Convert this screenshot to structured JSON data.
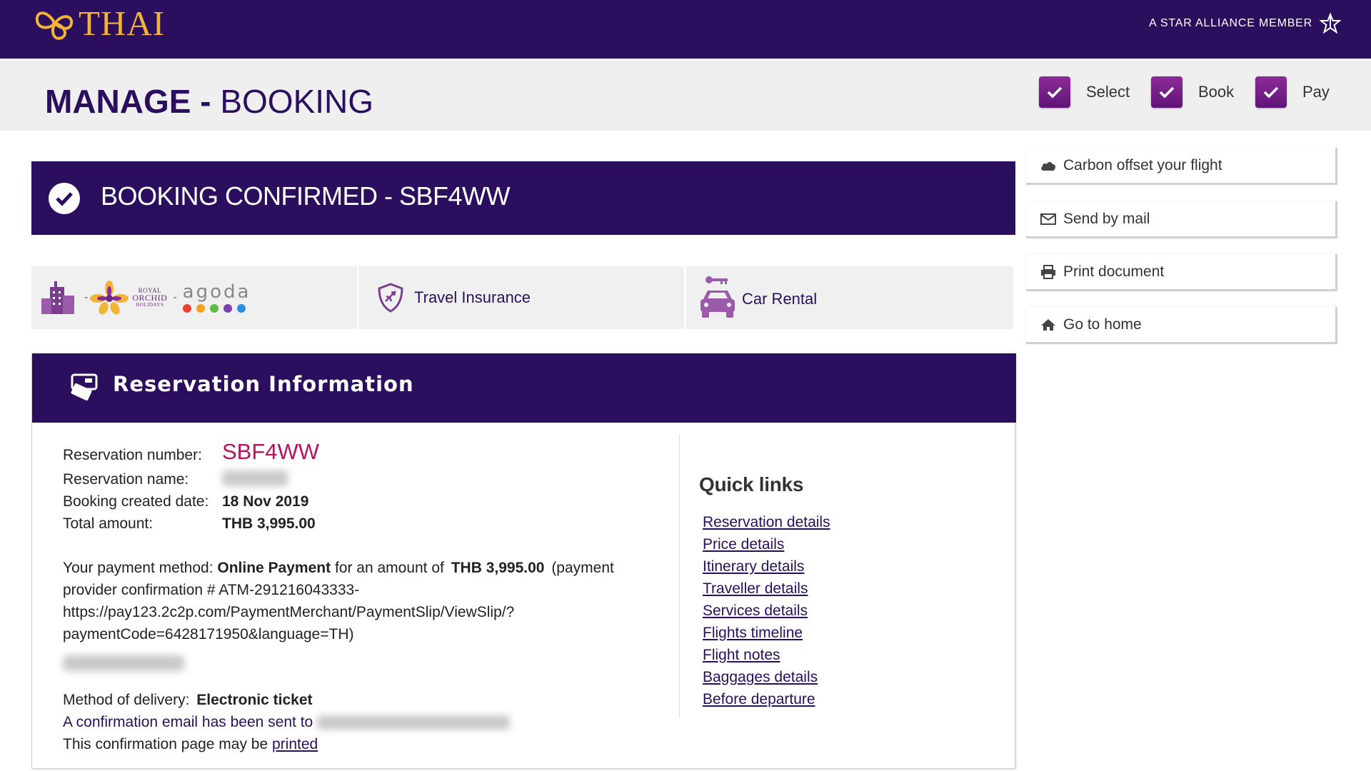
{
  "header": {
    "logo_text": "THAI",
    "alliance_text": "A STAR ALLIANCE MEMBER"
  },
  "page_title": {
    "bold": "MANAGE -",
    "light": "BOOKING"
  },
  "steps": [
    {
      "label": "Select",
      "done": true
    },
    {
      "label": "Book",
      "done": true
    },
    {
      "label": "Pay",
      "done": true
    }
  ],
  "confirmation": {
    "title": "BOOKING CONFIRMED - SBF4WW"
  },
  "partners": {
    "royal_orchid_lines": [
      "ROYAL",
      "ORCHID",
      "HOLIDAYS"
    ],
    "agoda": "agoda",
    "travel_insurance": "Travel Insurance",
    "car_rental": "Car Rental"
  },
  "side_menu": [
    {
      "label": "Carbon offset your flight",
      "icon": "cloud-icon"
    },
    {
      "label": "Send by mail",
      "icon": "envelope-icon"
    },
    {
      "label": "Print document",
      "icon": "printer-icon"
    },
    {
      "label": "Go to home",
      "icon": "home-icon"
    }
  ],
  "reservation": {
    "title": "Reservation Information",
    "number_label": "Reservation number:",
    "number_value": "SBF4WW",
    "name_label": "Reservation name:",
    "created_label": "Booking created date:",
    "created_value": "18 Nov 2019",
    "total_label": "Total amount:",
    "total_value": "THB 3,995.00",
    "payment": {
      "prefix": "Your payment method:",
      "method": "Online Payment",
      "middle": "for an amount of",
      "amount": "THB 3,995.00",
      "suffix": "(payment",
      "line2": "provider confirmation # ATM-291216043333-",
      "line3": "https://pay123.2c2p.com/PaymentMerchant/PaymentSlip/ViewSlip/?",
      "line4": "paymentCode=6428171950&language=TH)"
    },
    "delivery_label": "Method of delivery:",
    "delivery_value": "Electronic ticket",
    "email_sent_text": "A confirmation email has been sent to",
    "printable_text": "This confirmation page may be",
    "printed_link": "printed"
  },
  "quick_links": {
    "title": "Quick links",
    "items": [
      "Reservation details",
      "Price details",
      "Itinerary details",
      "Traveller details",
      "Services details",
      "Flights timeline",
      "Flight notes",
      "Baggages details",
      "Before departure"
    ]
  },
  "colors": {
    "brand_purple": "#2b0f5e",
    "gold": "#f2b339",
    "check_magenta": "#7a2088",
    "pnr_red": "#b3135f"
  }
}
